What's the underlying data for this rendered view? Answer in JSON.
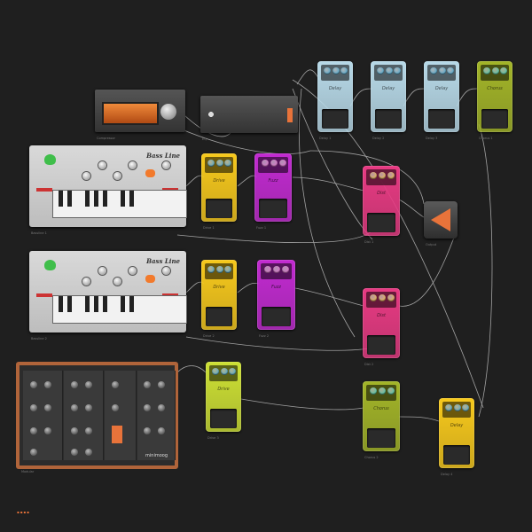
{
  "bassline": [
    {
      "title": "Bass Line",
      "caption": "Bassline 1"
    },
    {
      "title": "Bass Line",
      "caption": "Bassline 2"
    }
  ],
  "pedals": [
    {
      "id": "p1",
      "label": "Delay",
      "caption": "Delay 1",
      "color": "#b7d9e8"
    },
    {
      "id": "p2",
      "label": "Delay",
      "caption": "Delay 2",
      "color": "#b7d9e8"
    },
    {
      "id": "p3",
      "label": "Delay",
      "caption": "Delay 3",
      "color": "#b7d9e8"
    },
    {
      "id": "p4",
      "label": "Chorus",
      "caption": "Chorus 1",
      "color": "#a3b528"
    },
    {
      "id": "p5",
      "label": "Drive",
      "caption": "Drive 1",
      "color": "#f7c91c"
    },
    {
      "id": "p6",
      "label": "Fuzz",
      "caption": "Fuzz 1",
      "color": "#c22ad1"
    },
    {
      "id": "p7",
      "label": "Dist",
      "caption": "Dist 1",
      "color": "#e83a83"
    },
    {
      "id": "p8",
      "label": "Drive",
      "caption": "Drive 2",
      "color": "#f7c91c"
    },
    {
      "id": "p9",
      "label": "Fuzz",
      "caption": "Fuzz 2",
      "color": "#c22ad1"
    },
    {
      "id": "p10",
      "label": "Dist",
      "caption": "Dist 2",
      "color": "#e83a83"
    },
    {
      "id": "p11",
      "label": "Drive",
      "caption": "Drive 3",
      "color": "#cde034"
    },
    {
      "id": "p12",
      "label": "Chorus",
      "caption": "Chorus 2",
      "color": "#a3b528"
    },
    {
      "id": "p13",
      "label": "Delay",
      "caption": "Delay 4",
      "color": "#f7c91c"
    }
  ],
  "racks": [
    {
      "caption": "Compressor"
    },
    {
      "caption": "EQ"
    }
  ],
  "modular": {
    "caption": "Modular",
    "brand": "minimoog"
  },
  "triangle": {
    "caption": "Output"
  },
  "status": "▪▪▪▪",
  "colors": {
    "cable": "#b9b9b9",
    "accent": "#e8733a",
    "background": "#1f1f1f"
  }
}
